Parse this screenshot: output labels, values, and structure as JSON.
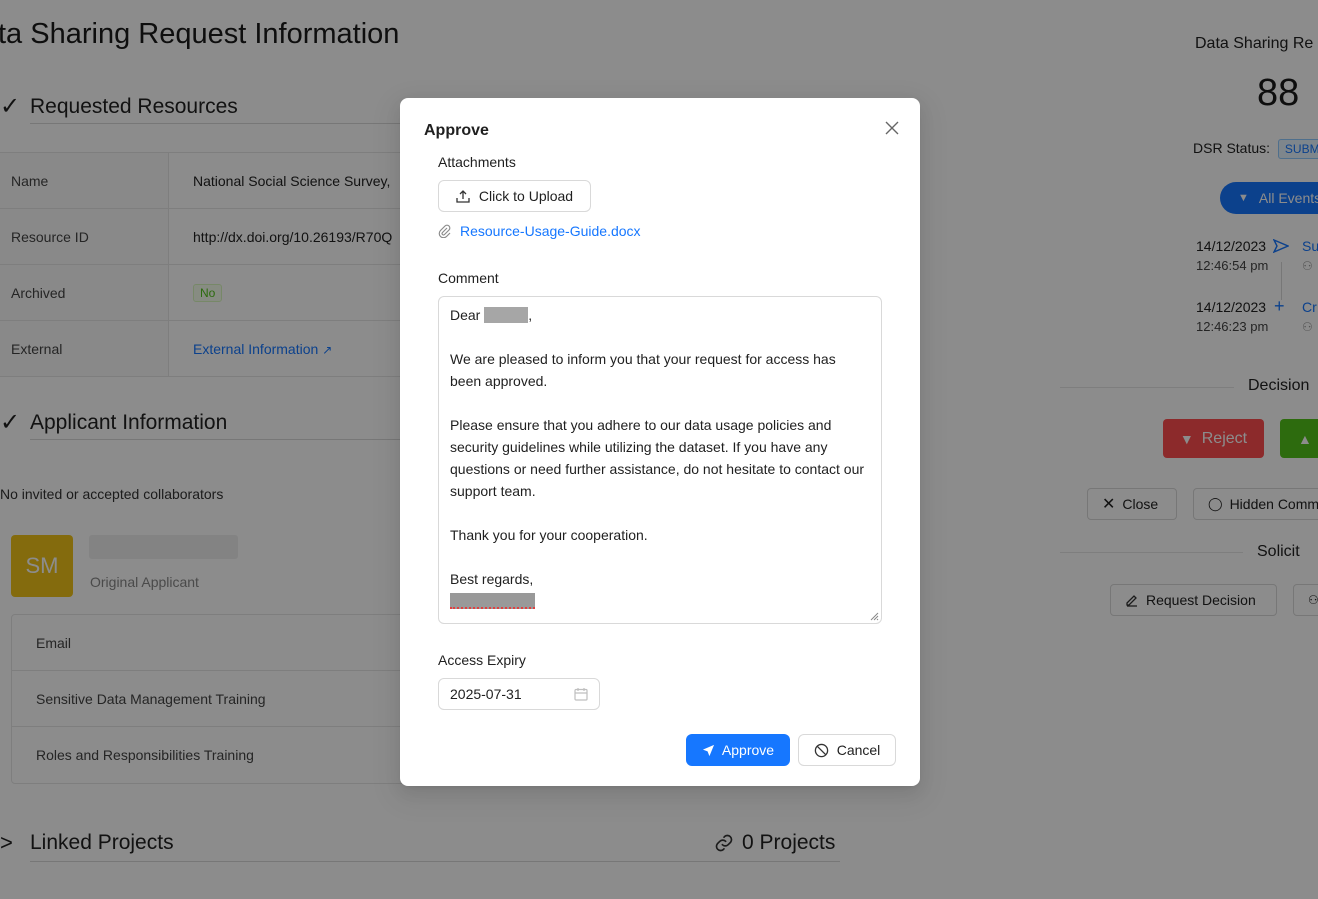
{
  "page": {
    "title": "ta Sharing Request Information",
    "sections": {
      "requested_resources": "Requested Resources",
      "applicant_information": "Applicant Information",
      "linked_projects": "Linked Projects"
    },
    "resources": [
      {
        "key": "Name",
        "value": "National Social Science Survey,"
      },
      {
        "key": "Resource ID",
        "value": "http://dx.doi.org/10.26193/R70Q"
      },
      {
        "key": "Archived",
        "value": "No"
      },
      {
        "key": "External",
        "value": "External Information"
      }
    ],
    "no_collaborators": "No invited or accepted collaborators",
    "applicant": {
      "initials": "SM",
      "role": "Original Applicant",
      "rows": [
        "Email",
        "Sensitive Data Management Training",
        "Roles and Responsibilities Training"
      ]
    },
    "projects_count": "0 Projects"
  },
  "sidebar": {
    "title": "Data Sharing Re",
    "number": "88",
    "status_label": "DSR Status:",
    "status_value": "SUBM",
    "all_events": "All Events",
    "events": [
      {
        "date": "14/12/2023",
        "time": "12:46:54 pm",
        "action": "Su",
        "icon": "send-icon"
      },
      {
        "date": "14/12/2023",
        "time": "12:46:23 pm",
        "action": "Cr",
        "icon": "plus-icon"
      }
    ],
    "decision_label": "Decision",
    "reject_label": "Reject",
    "close_label": "Close",
    "hidden_comments_label": "Hidden Comm",
    "solicit_label": "Solicit",
    "request_decision_label": "Request Decision"
  },
  "modal": {
    "title": "Approve",
    "attachments_label": "Attachments",
    "upload_label": "Click to Upload",
    "attachment_file": "Resource-Usage-Guide.docx",
    "comment_label": "Comment",
    "comment": {
      "salutation": "Dear",
      "para1": "We are pleased to inform you that your request for access has been approved.",
      "para2": "Please ensure that you adhere to our data usage policies and security guidelines while utilizing the dataset. If you have any questions or need further assistance, do not hesitate to contact our support team.",
      "para3": "Thank you for your cooperation.",
      "closing": "Best regards,"
    },
    "expiry_label": "Access Expiry",
    "expiry_value": "2025-07-31",
    "approve_label": "Approve",
    "cancel_label": "Cancel"
  },
  "colors": {
    "primary": "#1677ff",
    "danger": "#ff4d4f",
    "success": "#52c41a",
    "avatar": "#f0c419"
  }
}
